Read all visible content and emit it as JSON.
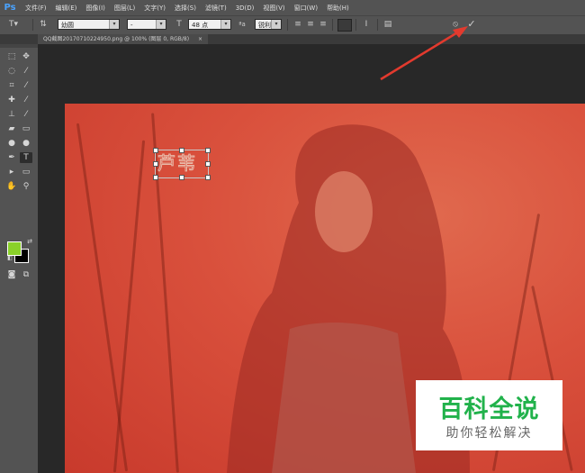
{
  "app": {
    "logo": "Ps"
  },
  "menu": [
    "文件(F)",
    "编辑(E)",
    "图像(I)",
    "图层(L)",
    "文字(Y)",
    "选择(S)",
    "滤镜(T)",
    "3D(D)",
    "视图(V)",
    "窗口(W)",
    "帮助(H)"
  ],
  "options": {
    "font_family": "幼圆",
    "font_style": "-",
    "font_size": "48 点",
    "anti_alias_icon": "aa-icon",
    "anti_alias": "锐利",
    "cancel_icon": "cancel-icon",
    "commit_icon": "commit-icon"
  },
  "document": {
    "tab_title": "QQ截图20170710224950.png @ 100% (图层 0, RGB/8)",
    "close_symbol": "×"
  },
  "canvas": {
    "text_layer": "芦苇"
  },
  "watermark": {
    "title": "百科全说",
    "subtitle": "助你轻松解决"
  },
  "colors": {
    "accent_blue": "#4aa3ff",
    "foreground_swatch": "#8ad12a",
    "background_swatch": "#000000",
    "photo_tint": "#d9503c",
    "watermark_green": "#21b24b",
    "annotation_arrow": "#e23a2e"
  }
}
